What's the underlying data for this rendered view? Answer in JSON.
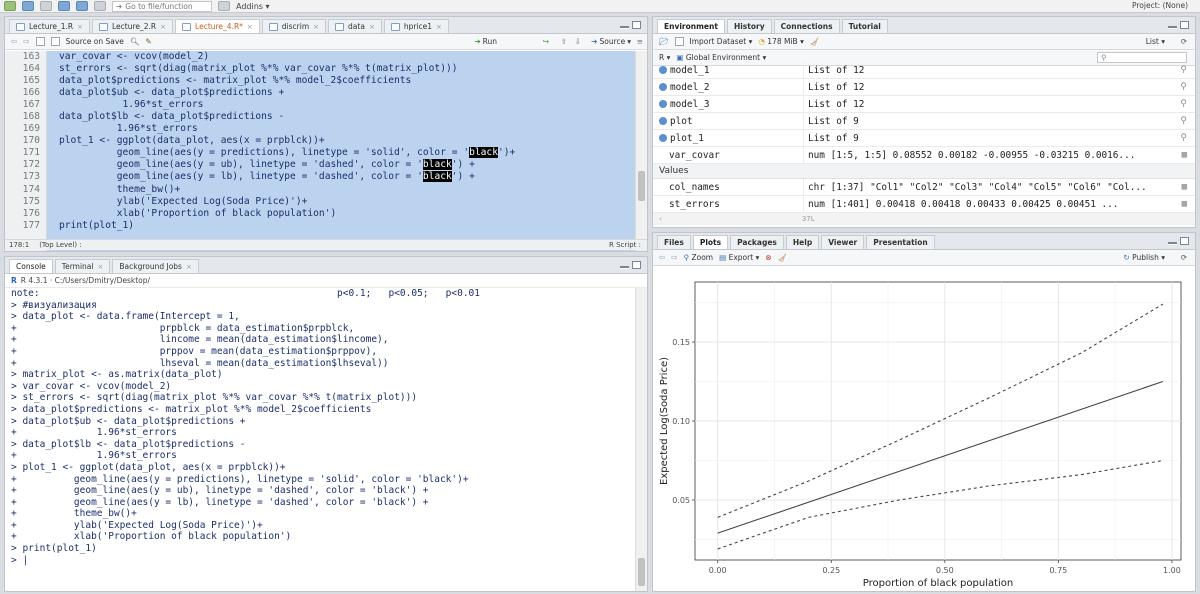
{
  "topbar": {
    "goto_placeholder": "Go to file/function",
    "addins_label": "Addins",
    "project_label": "Project: (None)"
  },
  "source_pane": {
    "tabs": [
      {
        "label": "Lecture_1.R",
        "active": false
      },
      {
        "label": "Lecture_2.R",
        "active": false
      },
      {
        "label": "Lecture_4.R*",
        "active": true
      },
      {
        "label": "discrim",
        "active": false
      },
      {
        "label": "data",
        "active": false
      },
      {
        "label": "hprice1",
        "active": false
      }
    ],
    "source_on_save_label": "Source on Save",
    "run_label": "Run",
    "source_label": "Source",
    "line_numbers": [
      "163",
      "164",
      "165",
      "166",
      "167",
      "168",
      "169",
      "170",
      "171",
      "172",
      "173",
      "174",
      "175",
      "176",
      "177"
    ],
    "code_lines": [
      "var_covar <- vcov(model_2)",
      "st_errors <- sqrt(diag(matrix_plot %*% var_covar %*% t(matrix_plot)))",
      "data_plot$predictions <- matrix_plot %*% model_2$coefficients",
      "data_plot$ub <- data_plot$predictions +",
      "           1.96*st_errors",
      "data_plot$lb <- data_plot$predictions -",
      "          1.96*st_errors",
      "plot_1 <- ggplot(data_plot, aes(x = prpblck))+",
      "          geom_line(aes(y = predictions), linetype = 'solid', color = '",
      "          geom_line(aes(y = ub), linetype = 'dashed', color = '",
      "          geom_line(aes(y = lb), linetype = 'dashed', color = '",
      "          theme_bw()+",
      "          ylab('Expected Log(Soda Price)')+",
      "          xlab('Proportion of black population')",
      "print(plot_1)"
    ],
    "highlight_word": "black",
    "highlight_tail_1": "')+",
    "highlight_tail_2": "') +",
    "status_position": "178:1",
    "status_scope": "(Top Level) :",
    "status_type": "R Script :"
  },
  "console_pane": {
    "tabs": [
      {
        "label": "Console",
        "active": true
      },
      {
        "label": "Terminal",
        "active": false
      },
      {
        "label": "Background Jobs",
        "active": false
      }
    ],
    "path": "R 4.3.1 · C:/Users/Dmitry/Desktop/",
    "lines": [
      "note:                                                    p<0.1;   p<0.05;   p<0.01",
      "> #визуализация",
      "> data_plot <- data.frame(Intercept = 1,",
      "+                         prpblck = data_estimation$prpblck,",
      "+                         lincome = mean(data_estimation$lincome),",
      "+                         prppov = mean(data_estimation$prppov),",
      "+                         lhseval = mean(data_estimation$lhseval))",
      "> matrix_plot <- as.matrix(data_plot)",
      "> var_covar <- vcov(model_2)",
      "> st_errors <- sqrt(diag(matrix_plot %*% var_covar %*% t(matrix_plot)))",
      "> data_plot$predictions <- matrix_plot %*% model_2$coefficients",
      "> data_plot$ub <- data_plot$predictions +",
      "+              1.96*st_errors",
      "> data_plot$lb <- data_plot$predictions -",
      "+              1.96*st_errors",
      "> plot_1 <- ggplot(data_plot, aes(x = prpblck))+",
      "+          geom_line(aes(y = predictions), linetype = 'solid', color = 'black')+",
      "+          geom_line(aes(y = ub), linetype = 'dashed', color = 'black') +",
      "+          geom_line(aes(y = lb), linetype = 'dashed', color = 'black') +",
      "+          theme_bw()+",
      "+          ylab('Expected Log(Soda Price)')+",
      "+          xlab('Proportion of black population')",
      "> print(plot_1)",
      "> |"
    ]
  },
  "env_pane": {
    "tabs": [
      {
        "label": "Environment",
        "active": true
      },
      {
        "label": "History",
        "active": false
      },
      {
        "label": "Connections",
        "active": false
      },
      {
        "label": "Tutorial",
        "active": false
      }
    ],
    "import_label": "Import Dataset",
    "memory_label": "178 MiB",
    "list_label": "List",
    "lang_label": "R",
    "scope_label": "Global Environment",
    "rows": [
      {
        "name": "model_1",
        "value": "List of  12",
        "dot": true
      },
      {
        "name": "model_2",
        "value": "List of  12",
        "dot": true
      },
      {
        "name": "model_3",
        "value": "List of  12",
        "dot": true
      },
      {
        "name": "plot",
        "value": "List of  9",
        "dot": true
      },
      {
        "name": "plot_1",
        "value": "List of  9",
        "dot": true
      },
      {
        "name": "var_covar",
        "value": "num [1:5, 1:5] 0.08552 0.00182 -0.00955 -0.03215 0.0016...",
        "dot": false
      }
    ],
    "values_label": "Values",
    "values_rows": [
      {
        "name": "col_names",
        "value": "chr [1:37] \"Col1\" \"Col2\" \"Col3\" \"Col4\" \"Col5\" \"Col6\" \"Col..."
      },
      {
        "name": "st_errors",
        "value": "num [1:401] 0.00418 0.00418 0.00433 0.00425 0.00451 ..."
      }
    ],
    "bottom_hint": "37L"
  },
  "plots_pane": {
    "tabs": [
      {
        "label": "Files",
        "active": false
      },
      {
        "label": "Plots",
        "active": true
      },
      {
        "label": "Packages",
        "active": false
      },
      {
        "label": "Help",
        "active": false
      },
      {
        "label": "Viewer",
        "active": false
      },
      {
        "label": "Presentation",
        "active": false
      }
    ],
    "zoom_label": "Zoom",
    "export_label": "Export",
    "publish_label": "Publish"
  },
  "chart_data": {
    "type": "line",
    "title": "",
    "xlabel": "Proportion of black population",
    "ylabel": "Expected Log(Soda Price)",
    "xlim": [
      -0.05,
      1.02
    ],
    "ylim": [
      0.012,
      0.188
    ],
    "xticks": [
      0.0,
      0.25,
      0.5,
      0.75,
      1.0
    ],
    "xtick_labels": [
      "0.00",
      "0.25",
      "0.50",
      "0.75",
      "1.00"
    ],
    "yticks": [
      0.05,
      0.1,
      0.15
    ],
    "ytick_labels": [
      "0.05",
      "0.10",
      "0.15"
    ],
    "grid": true,
    "series": [
      {
        "linetype": "solid",
        "x": [
          0.0,
          0.98
        ],
        "y": [
          0.029,
          0.125
        ]
      },
      {
        "linetype": "dashed",
        "x": [
          0.0,
          0.2,
          0.4,
          0.6,
          0.8,
          0.98
        ],
        "y": [
          0.039,
          0.062,
          0.088,
          0.115,
          0.143,
          0.174
        ]
      },
      {
        "linetype": "dashed",
        "x": [
          0.0,
          0.2,
          0.4,
          0.6,
          0.8,
          0.98
        ],
        "y": [
          0.019,
          0.039,
          0.05,
          0.059,
          0.066,
          0.075
        ]
      }
    ]
  }
}
